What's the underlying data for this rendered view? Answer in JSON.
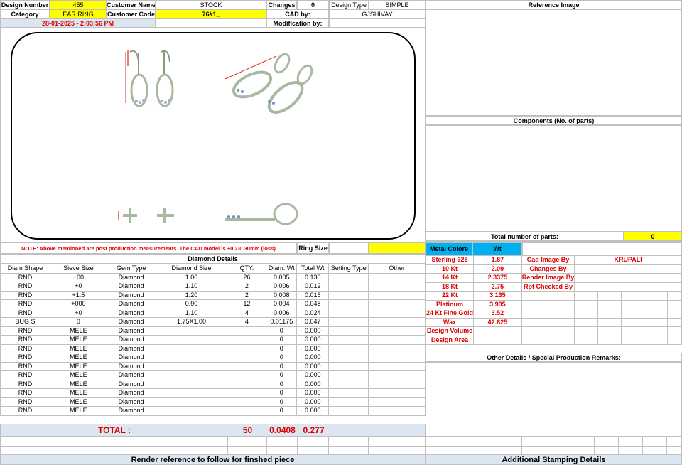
{
  "header": {
    "design_number_label": "Design Number",
    "design_number": "455",
    "customer_name_label": "Customer Name",
    "customer_name": "STOCK",
    "changes_label": "Changes",
    "changes": "0",
    "design_type_label": "Design Type",
    "design_type": "SIMPLE",
    "category_label": "Category",
    "category": "EAR RING",
    "customer_code_label": "Customer Code",
    "customer_code": "76#1_",
    "cad_by_label": "CAD by:",
    "cad_by": "GJSHIVAY",
    "datetime": "28-01-2025 - 2:03:56 PM",
    "modification_label": "Modification by:",
    "modification": ""
  },
  "note": {
    "text": "NOTE: Above mentioned are post production measurements. The CAD model is +0.2-0.30mm (loss)",
    "ring_size_label": "Ring Size",
    "ring_size": ""
  },
  "diamond_details": {
    "title": "Diamond Details",
    "columns": [
      "Diam Shape",
      "Sieve Size",
      "Gem Type",
      "Diamond Size",
      "QTY.",
      "Diam. Wt",
      "Total Wt",
      "Setting Type",
      "Other"
    ],
    "rows": [
      [
        "RND",
        "+00",
        "Diamond",
        "1.00",
        "26",
        "0.005",
        "0.130",
        "",
        ""
      ],
      [
        "RND",
        "+0",
        "Diamond",
        "1.10",
        "2",
        "0.006",
        "0.012",
        "",
        ""
      ],
      [
        "RND",
        "+1.5",
        "Diamond",
        "1.20",
        "2",
        "0.008",
        "0.016",
        "",
        ""
      ],
      [
        "RND",
        "+000",
        "Diamond",
        "0.90",
        "12",
        "0.004",
        "0.048",
        "",
        ""
      ],
      [
        "RND",
        "+0",
        "Diamond",
        "1.10",
        "4",
        "0.006",
        "0.024",
        "",
        ""
      ],
      [
        "BUG S",
        "0",
        "Diamond",
        "1.75X1.00",
        "4",
        "0.01175",
        "0.047",
        "",
        ""
      ],
      [
        "RND",
        "MELE",
        "Diamond",
        "",
        "",
        "0",
        "0.000",
        "",
        ""
      ],
      [
        "RND",
        "MELE",
        "Diamond",
        "",
        "",
        "0",
        "0.000",
        "",
        ""
      ],
      [
        "RND",
        "MELE",
        "Diamond",
        "",
        "",
        "0",
        "0.000",
        "",
        ""
      ],
      [
        "RND",
        "MELE",
        "Diamond",
        "",
        "",
        "0",
        "0.000",
        "",
        ""
      ],
      [
        "RND",
        "MELE",
        "Diamond",
        "",
        "",
        "0",
        "0.000",
        "",
        ""
      ],
      [
        "RND",
        "MELE",
        "Diamond",
        "",
        "",
        "0",
        "0.000",
        "",
        ""
      ],
      [
        "RND",
        "MELE",
        "Diamond",
        "",
        "",
        "0",
        "0.000",
        "",
        ""
      ],
      [
        "RND",
        "MELE",
        "Diamond",
        "",
        "",
        "0",
        "0.000",
        "",
        ""
      ],
      [
        "RND",
        "MELE",
        "Diamond",
        "",
        "",
        "0",
        "0.000",
        "",
        ""
      ],
      [
        "RND",
        "MELE",
        "Diamond",
        "",
        "",
        "0",
        "0.000",
        "",
        ""
      ]
    ],
    "total_label": "TOTAL :",
    "total_qty": "50",
    "total_diam_wt": "0.0408",
    "total_wt": "0.277"
  },
  "reference": {
    "title": "Reference Image",
    "components_title": "Components (No. of parts)",
    "total_parts_label": "Total number of parts:",
    "total_parts": "0"
  },
  "metal": {
    "colore_label": "Metal Colore",
    "wt_label": "Wt",
    "rows": [
      {
        "name": "Sterling 925",
        "wt": "1.87"
      },
      {
        "name": "10 Kt",
        "wt": "2.09"
      },
      {
        "name": "14 Kt",
        "wt": "2.3375"
      },
      {
        "name": "18 Kt",
        "wt": "2.75"
      },
      {
        "name": "22 Kt",
        "wt": "3.135"
      },
      {
        "name": "Platinum",
        "wt": "3.905"
      },
      {
        "name": "24 Kt Fine Gold",
        "wt": "3.52"
      },
      {
        "name": "Wax",
        "wt": "42.625"
      },
      {
        "name": "Design Volume",
        "wt": ""
      },
      {
        "name": "Design Area",
        "wt": ""
      }
    ],
    "cad_image_by_label": "Cad Image By",
    "cad_image_by": "KRUPALI",
    "changes_by_label": "Changes By",
    "render_image_by_label": "Render Image By",
    "rpt_checked_by_label": "Rpt Checked By"
  },
  "other_details_title": "Other Details / Special Production Remarks:",
  "footer": {
    "render_reference": "Render reference to follow for finshed piece",
    "stamping": "Additional Stamping Details"
  },
  "colors": {
    "yellow": "#ffff00",
    "light_blue": "#dce6f1",
    "metal_header_blue": "#00b0f0",
    "red_text": "#e00000"
  }
}
